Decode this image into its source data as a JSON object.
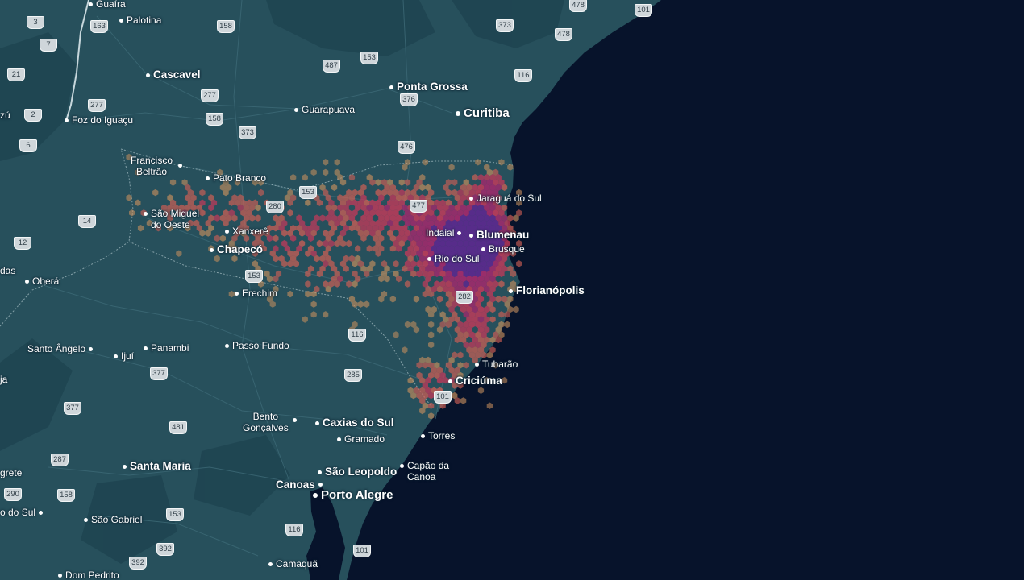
{
  "map": {
    "region": "Southern Brazil",
    "colors": {
      "land": "#27505c",
      "land_dark": "#1a3b48",
      "ocean": "#07132b",
      "roads": "#3d6a77",
      "borders": "#a9c0c6",
      "shield_bg": "#cfd6da",
      "labels": "#ffffff"
    },
    "heatmap_palette": [
      "#c9905e",
      "#cf5f55",
      "#c23a5a",
      "#a02a6c",
      "#5a2a8c"
    ],
    "cities": [
      {
        "name": "Guaíra"
      },
      {
        "name": "Palotina"
      },
      {
        "name": "Cascavel"
      },
      {
        "name": "Foz do Iguaçu"
      },
      {
        "name": "Ponta Grossa"
      },
      {
        "name": "Guarapuava"
      },
      {
        "name": "Curitiba"
      },
      {
        "name": "Francisco\nBeltrão"
      },
      {
        "name": "Pato Branco"
      },
      {
        "name": "Jaraguá do Sul"
      },
      {
        "name": "São Miguel\ndo Oeste"
      },
      {
        "name": "Xanxerê"
      },
      {
        "name": "Chapecó"
      },
      {
        "name": "Indaial"
      },
      {
        "name": "Blumenau"
      },
      {
        "name": "Brusque"
      },
      {
        "name": "Rio do Sul"
      },
      {
        "name": "Florianópolis"
      },
      {
        "name": "Oberá"
      },
      {
        "name": "Erechim"
      },
      {
        "name": "Santo Ângelo"
      },
      {
        "name": "Ijuí"
      },
      {
        "name": "Panambi"
      },
      {
        "name": "Passo Fundo"
      },
      {
        "name": "Tubarão"
      },
      {
        "name": "Criciúma"
      },
      {
        "name": "Bento\nGonçalves"
      },
      {
        "name": "Caxias do Sul"
      },
      {
        "name": "Gramado"
      },
      {
        "name": "Torres"
      },
      {
        "name": "Santa Maria"
      },
      {
        "name": "São Leopoldo"
      },
      {
        "name": "Capão da\nCanoa"
      },
      {
        "name": "Canoas"
      },
      {
        "name": "Porto Alegre"
      },
      {
        "name": "São Gabriel"
      },
      {
        "name": "Camaquã"
      },
      {
        "name": "Dom Pedrito"
      },
      {
        "name": "zú"
      },
      {
        "name": "das"
      },
      {
        "name": "ja"
      },
      {
        "name": "grete"
      },
      {
        "name": "o do Sul"
      }
    ],
    "highways": [
      "478",
      "101",
      "3",
      "163",
      "373",
      "478",
      "158",
      "7",
      "487",
      "153",
      "116",
      "21",
      "277",
      "376",
      "2",
      "277",
      "158",
      "373",
      "6",
      "476",
      "153",
      "477",
      "280",
      "14",
      "12",
      "153",
      "282",
      "116",
      "377",
      "285",
      "101",
      "377",
      "481",
      "287",
      "290",
      "158",
      "153",
      "116",
      "101",
      "392"
    ]
  }
}
